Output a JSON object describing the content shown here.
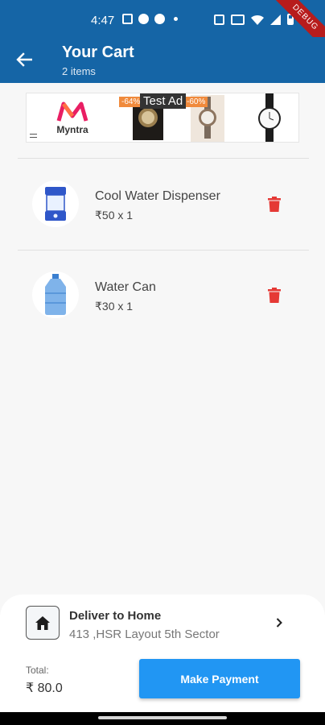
{
  "status_bar": {
    "time": "4:47",
    "left_icons": [
      "message-icon",
      "app-icon",
      "app-icon",
      "app-icon"
    ],
    "right_icons": [
      "nfc-icon",
      "cast-icon",
      "wifi-icon",
      "signal-icon",
      "battery-icon"
    ]
  },
  "debug_ribbon": "DEBUG",
  "app_bar": {
    "title": "Your Cart",
    "subtitle": "2 items",
    "back_icon": "arrow-back-icon",
    "color": "#1565a6"
  },
  "ad": {
    "label": "Test Ad",
    "brand": "Myntra",
    "discounts": [
      "-64%",
      "-60%"
    ]
  },
  "cart": {
    "items": [
      {
        "name": "Cool Water Dispenser",
        "price": "₹50 x 1",
        "image": "water-dispenser"
      },
      {
        "name": "Water Can",
        "price": "₹30 x 1",
        "image": "water-can"
      }
    ],
    "delete_icon": "trash-icon",
    "delete_color": "#e53935"
  },
  "delivery": {
    "title": "Deliver to Home",
    "address": "413 ,HSR Layout 5th Sector",
    "icon": "home-icon"
  },
  "summary": {
    "total_label": "Total:",
    "total_value": "₹ 80.0",
    "button_label": "Make Payment",
    "button_color": "#2196f3"
  }
}
